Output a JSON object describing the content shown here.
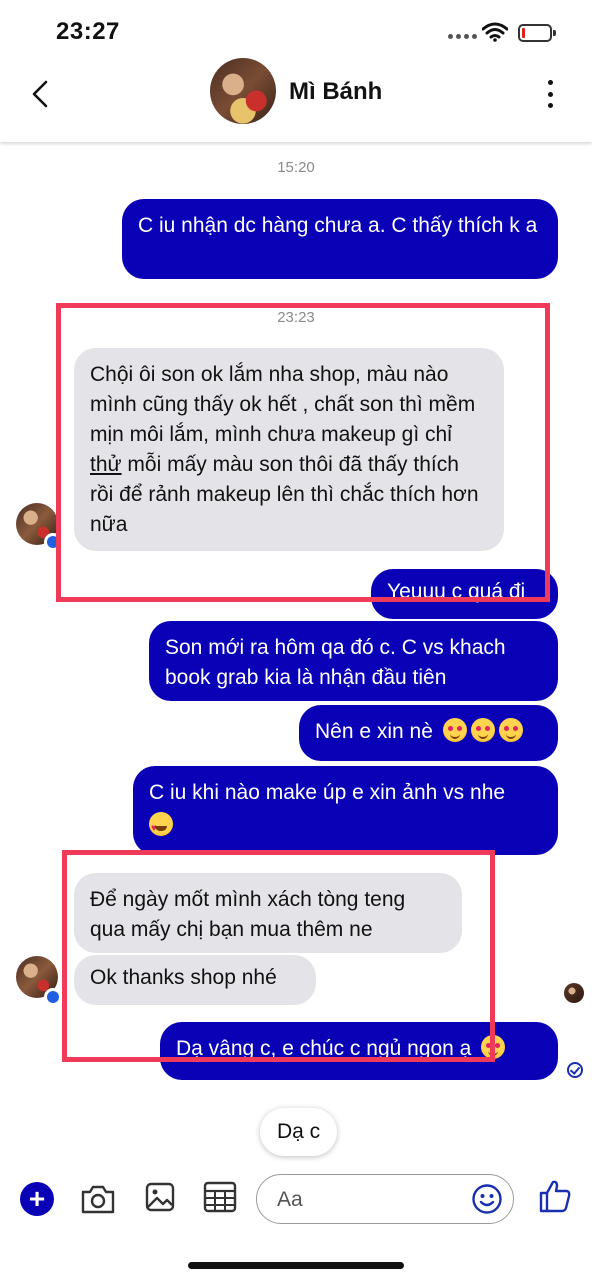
{
  "status_bar": {
    "time": "23:27"
  },
  "header": {
    "contact_name": "Mì Bánh"
  },
  "messages": {
    "ts1": "15:20",
    "m1": "C iu nhận dc hàng chưa a. C thấy thích k a",
    "ts2": "23:23",
    "m2_part1": "Chội ôi son ok lắm nha shop, màu nào mình cũng thấy ok hết , chất son thì mềm mịn môi lắm, mình chưa makeup gì chỉ ",
    "m2_underlined": "thử",
    "m2_part2": " mỗi mấy màu son thôi đã thấy thích rồi để rảnh makeup lên thì chắc thích hơn nữa",
    "m3": "Yeuuu c quá đi",
    "m4": "Son mới ra hôm qa đó c. C vs khach book grab kia là nhận đầu tiên",
    "m5": "Nên e xin nè",
    "m6": "C iu khi nào make úp e xin ảnh vs nhe",
    "m7": "Để ngày mốt mình xách tòng teng qua mấy chị bạn mua thêm ne",
    "m8": "Ok thanks shop nhé",
    "m9": "Dạ vâng c, e chúc c ngủ ngon ạ"
  },
  "quick_reply": {
    "label": "Dạ c"
  },
  "composer": {
    "placeholder": "Aa"
  },
  "colors": {
    "sent_bubble": "#0a00b6",
    "received_bubble": "#e4e3e8",
    "highlight_box": "#ef3b59"
  },
  "icons": [
    "back-icon",
    "more-icon",
    "plus-icon",
    "camera-icon",
    "gallery-icon",
    "sticker-grid-icon",
    "emoji-icon",
    "like-icon"
  ]
}
